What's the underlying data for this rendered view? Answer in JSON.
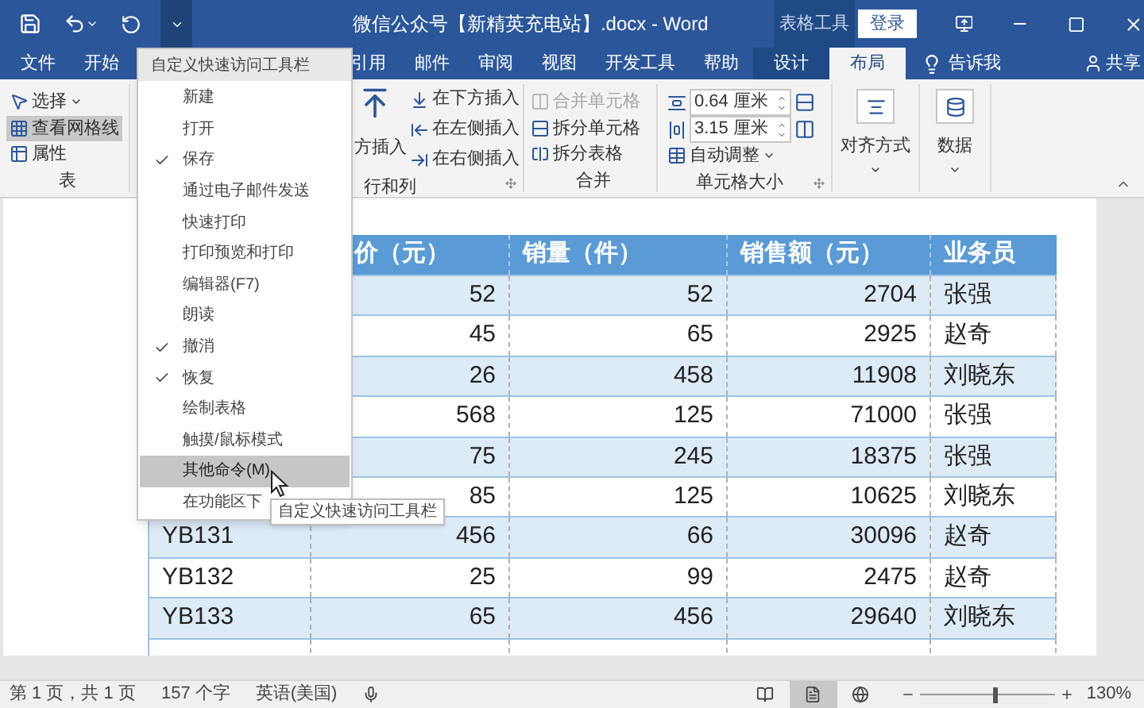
{
  "title_bar": {
    "quick_access": [
      {
        "kind": "save",
        "selected": false
      },
      {
        "kind": "undo",
        "selected": false
      },
      {
        "kind": "redo",
        "selected": false
      },
      {
        "kind": "customize",
        "selected": true
      }
    ],
    "title": "微信公众号【新精英充电站】.docx - Word",
    "context_group": "表格工具",
    "sign_in": "登录"
  },
  "tabs": [
    {
      "label": "文件",
      "selected": false,
      "context": false
    },
    {
      "label": "开始",
      "selected": false,
      "context": false
    },
    {
      "label": "引用",
      "selected": false,
      "context": false
    },
    {
      "label": "邮件",
      "selected": false,
      "context": false
    },
    {
      "label": "审阅",
      "selected": false,
      "context": false
    },
    {
      "label": "视图",
      "selected": false,
      "context": false
    },
    {
      "label": "开发工具",
      "selected": false,
      "context": false
    },
    {
      "label": "帮助",
      "selected": false,
      "context": false
    },
    {
      "label": "设计",
      "selected": false,
      "context": true
    },
    {
      "label": "布局",
      "selected": true,
      "context": true
    }
  ],
  "tell_me": "告诉我",
  "share": "共享",
  "ribbon": {
    "table": {
      "label": "表",
      "items": [
        {
          "label": "选择",
          "dropdown": true,
          "selected": false
        },
        {
          "label": "查看网格线",
          "dropdown": false,
          "selected": true
        },
        {
          "label": "属性",
          "dropdown": false,
          "selected": false
        }
      ]
    },
    "rows_columns": {
      "label": "行和列",
      "large": "方插入",
      "items": [
        "在下方插入",
        "在左侧插入",
        "在右侧插入"
      ]
    },
    "merge": {
      "label": "合并",
      "items": [
        {
          "label": "合并单元格",
          "disabled": true
        },
        {
          "label": "拆分单元格",
          "disabled": false
        },
        {
          "label": "拆分表格",
          "disabled": false
        }
      ]
    },
    "cell_size": {
      "label": "单元格大小",
      "height": "0.64 厘米",
      "width": "3.15 厘米",
      "autofit": "自动调整"
    },
    "alignment": "对齐方式",
    "data": "数据"
  },
  "menu": {
    "title": "自定义快速访问工具栏",
    "items": [
      {
        "label": "新建",
        "checked": false,
        "selected": false
      },
      {
        "label": "打开",
        "checked": false,
        "selected": false
      },
      {
        "label": "保存",
        "checked": true,
        "selected": false
      },
      {
        "label": "通过电子邮件发送",
        "checked": false,
        "selected": false
      },
      {
        "label": "快速打印",
        "checked": false,
        "selected": false
      },
      {
        "label": "打印预览和打印",
        "checked": false,
        "selected": false
      },
      {
        "label": "编辑器(F7)",
        "checked": false,
        "selected": false
      },
      {
        "label": "朗读",
        "checked": false,
        "selected": false
      },
      {
        "label": "撤消",
        "checked": true,
        "selected": false
      },
      {
        "label": "恢复",
        "checked": true,
        "selected": false
      },
      {
        "label": "绘制表格",
        "checked": false,
        "selected": false
      },
      {
        "label": "触摸/鼠标模式",
        "checked": false,
        "selected": false
      },
      {
        "label": "其他命令(M)",
        "checked": false,
        "selected": true
      },
      {
        "label": "在功能区下",
        "checked": false,
        "selected": false
      }
    ]
  },
  "tooltip": "自定义快速访问工具栏",
  "table": {
    "headers": [
      "价（元）",
      "销量（件）",
      "销售额（元）",
      "业务员"
    ],
    "rows": [
      {
        "cells": [
          "52",
          "52",
          "2704",
          "张强"
        ]
      },
      {
        "cells": [
          "45",
          "65",
          "2925",
          "赵奇"
        ]
      },
      {
        "cells": [
          "26",
          "458",
          "11908",
          "刘晓东"
        ]
      },
      {
        "cells": [
          "568",
          "125",
          "71000",
          "张强"
        ]
      },
      {
        "cells": [
          "75",
          "245",
          "18375",
          "张强"
        ]
      },
      {
        "cells": [
          "85",
          "125",
          "10625",
          "刘晓东"
        ]
      },
      {
        "id": "YB131",
        "cells": [
          "456",
          "66",
          "30096",
          "赵奇"
        ]
      },
      {
        "id": "YB132",
        "cells": [
          "25",
          "99",
          "2475",
          "赵奇"
        ]
      },
      {
        "id": "YB133",
        "cells": [
          "65",
          "456",
          "29640",
          "刘晓东"
        ]
      }
    ]
  },
  "status_bar": {
    "page": "第 1 页，共 1 页",
    "words": "157 个字",
    "language": "英语(美国)",
    "views": [
      {
        "kind": "read",
        "selected": false
      },
      {
        "kind": "print",
        "selected": true
      },
      {
        "kind": "web",
        "selected": false
      }
    ],
    "zoom_slider": {
      "level": 0.56
    },
    "zoom": "130%"
  }
}
